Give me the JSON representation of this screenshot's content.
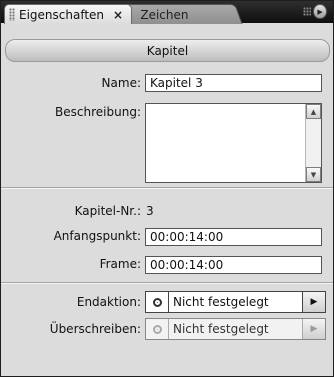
{
  "tabs": [
    {
      "label": "Eigenschaften",
      "active": true,
      "close": "×"
    },
    {
      "label": "Zeichen",
      "active": false
    }
  ],
  "panel_menu_icon": "panel-menu-icon",
  "header": {
    "title": "Kapitel"
  },
  "form": {
    "name_label": "Name:",
    "name_value": "Kapitel 3",
    "description_label": "Beschreibung:",
    "description_value": "",
    "chapter_no_label": "Kapitel-Nr.:",
    "chapter_no_value": "3",
    "start_label": "Anfangspunkt:",
    "start_value": "00:00:14:00",
    "frame_label": "Frame:",
    "frame_value": "00:00:14:00",
    "end_action_label": "Endaktion:",
    "end_action_value": "Nicht festgelegt",
    "override_label": "Überschreiben:",
    "override_value": "Nicht festgelegt"
  }
}
